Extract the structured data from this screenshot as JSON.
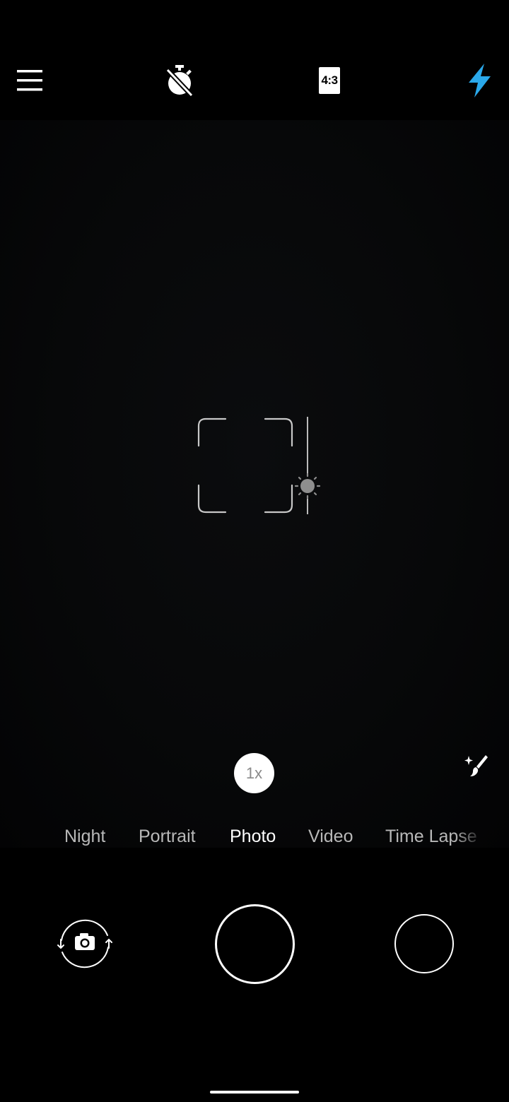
{
  "top_bar": {
    "menu_icon": "hamburger-menu-icon",
    "timer_icon": "timer-off-icon",
    "aspect_ratio": "4:3",
    "flash_icon": "flash-on-icon",
    "flash_color": "#2aa8ea"
  },
  "viewfinder": {
    "focus_icon": "focus-frame-icon",
    "exposure_icon": "exposure-sun-icon"
  },
  "zoom": {
    "label": "1x"
  },
  "beauty_icon": "beauty-magic-wand-icon",
  "modes": {
    "items": [
      "Night",
      "Portrait",
      "Photo",
      "Video",
      "Time Lapse"
    ],
    "active": "Photo"
  },
  "bottom_controls": {
    "switch_camera_icon": "switch-camera-icon",
    "shutter_icon": "shutter-button",
    "gallery_icon": "gallery-thumbnail"
  }
}
